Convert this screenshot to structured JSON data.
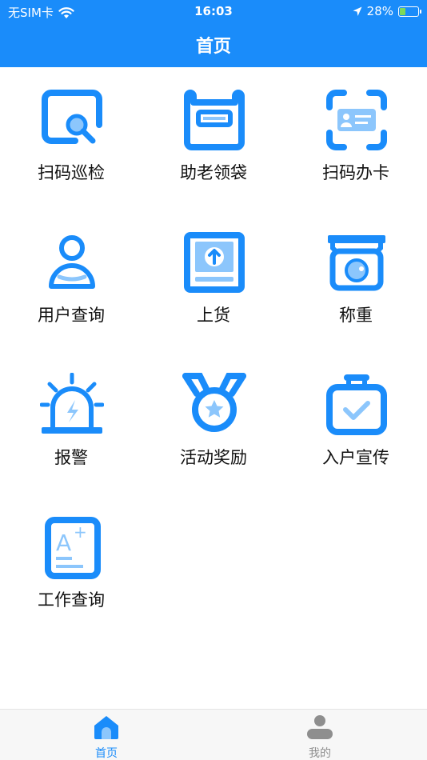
{
  "status_bar": {
    "carrier": "无SIM卡",
    "time": "16:03",
    "battery": "28%"
  },
  "header": {
    "title": "首页"
  },
  "grid_items": [
    {
      "label": "扫码巡检",
      "icon": "scan-inspect-icon"
    },
    {
      "label": "助老领袋",
      "icon": "bag-icon"
    },
    {
      "label": "扫码办卡",
      "icon": "scan-card-icon"
    },
    {
      "label": "用户查询",
      "icon": "user-icon"
    },
    {
      "label": "上货",
      "icon": "upload-icon"
    },
    {
      "label": "称重",
      "icon": "scale-icon"
    },
    {
      "label": "报警",
      "icon": "alarm-light-icon"
    },
    {
      "label": "活动奖励",
      "icon": "medal-icon"
    },
    {
      "label": "入户宣传",
      "icon": "check-bag-icon"
    },
    {
      "label": "工作查询",
      "icon": "work-report-icon"
    }
  ],
  "tabbar": {
    "home": {
      "label": "首页",
      "active": true
    },
    "mine": {
      "label": "我的",
      "active": false
    }
  },
  "colors": {
    "primary": "#1a8cfa",
    "light": "#8cc6fc",
    "inactive": "#8e8e8e"
  }
}
